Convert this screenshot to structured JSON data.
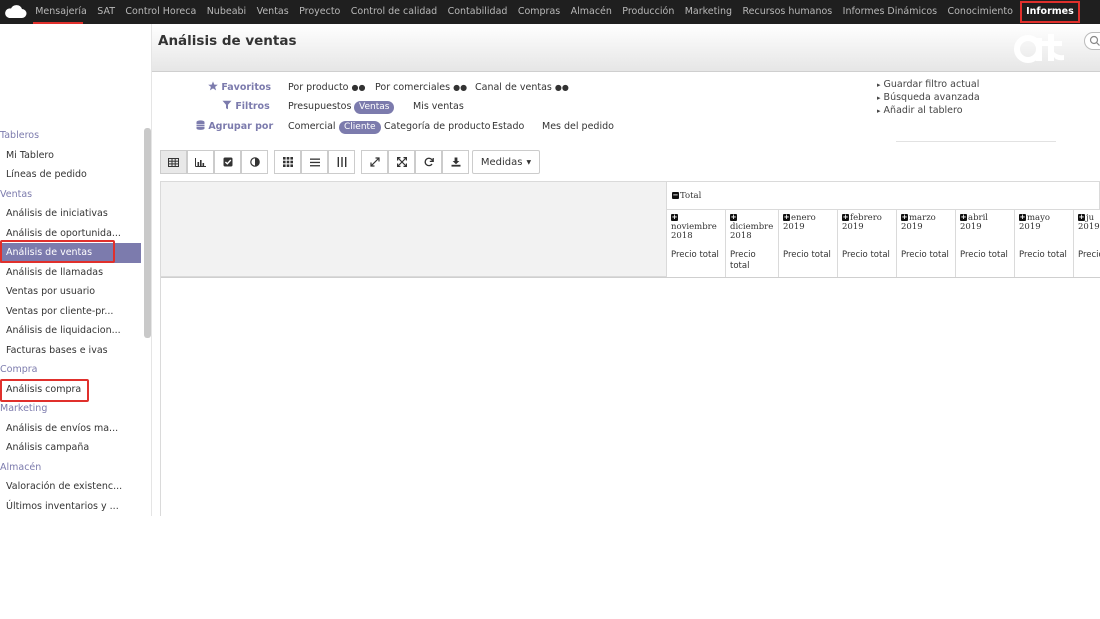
{
  "topbar": {
    "menu": [
      "Mensajería",
      "SAT",
      "Control Horeca",
      "Nubeabi",
      "Ventas",
      "Proyecto",
      "Control de calidad",
      "Contabilidad",
      "Compras",
      "Almacén",
      "Producción",
      "Marketing",
      "Recursos humanos",
      "Informes Dinámicos",
      "Conocimiento"
    ],
    "active": "Informes"
  },
  "sidebar": {
    "sections": [
      {
        "title": "Tableros",
        "items": [
          "Mi Tablero",
          "Líneas de pedido"
        ]
      },
      {
        "title": "Ventas",
        "items": [
          "Análisis de iniciativas",
          "Análisis de oportunida...",
          "Análisis de ventas",
          "Análisis de llamadas",
          "Ventas por usuario",
          "Ventas por cliente-pr...",
          "Análisis de liquidacion...",
          "Facturas bases e ivas"
        ]
      },
      {
        "title": "Compra",
        "items": [
          "Análisis compra"
        ]
      },
      {
        "title": "Marketing",
        "items": [
          "Análisis de envíos ma...",
          "Análisis campaña"
        ]
      },
      {
        "title": "Almacén",
        "items": [
          "Valoración de existenc...",
          "Últimos inventarios y ..."
        ]
      }
    ],
    "active_item": "Análisis de ventas"
  },
  "header": {
    "title": "Análisis de ventas"
  },
  "filters": {
    "favoritos_label": "Favoritos",
    "filtros_label": "Filtros",
    "agrupar_label": "Agrupar por",
    "favoritos": [
      "Por producto",
      "Por comerciales",
      "Canal de ventas"
    ],
    "filtros": {
      "presupuestos": "Presupuestos",
      "ventas": "Ventas",
      "mis_ventas": "Mis ventas"
    },
    "agrupar": {
      "comercial": "Comercial",
      "cliente": "Cliente",
      "categoria": "Categoría de producto",
      "estado": "Estado",
      "mes": "Mes del pedido"
    },
    "links": [
      "Guardar filtro actual",
      "Búsqueda avanzada",
      "Añadir al tablero"
    ]
  },
  "toolbar": {
    "measures_label": "Medidas"
  },
  "pivot": {
    "total_label": "Total",
    "measure": "Precio total",
    "measure_wrapped": [
      "Precio",
      "total"
    ],
    "columns": [
      {
        "month": "noviembre",
        "year": "2018"
      },
      {
        "month": "diciembre",
        "year": "2018"
      },
      {
        "month": "enero",
        "year": "2019"
      },
      {
        "month": "febrero",
        "year": "2019"
      },
      {
        "month": "marzo",
        "year": "2019"
      },
      {
        "month": "abril",
        "year": "2019"
      },
      {
        "month": "mayo",
        "year": "2019"
      },
      {
        "month": "ju",
        "year": "2019"
      }
    ],
    "last_measure": "Precio"
  },
  "colors": {
    "accent": "#7c7bad",
    "topbar": "#1f1f1f",
    "highlight": "#e0302c"
  }
}
